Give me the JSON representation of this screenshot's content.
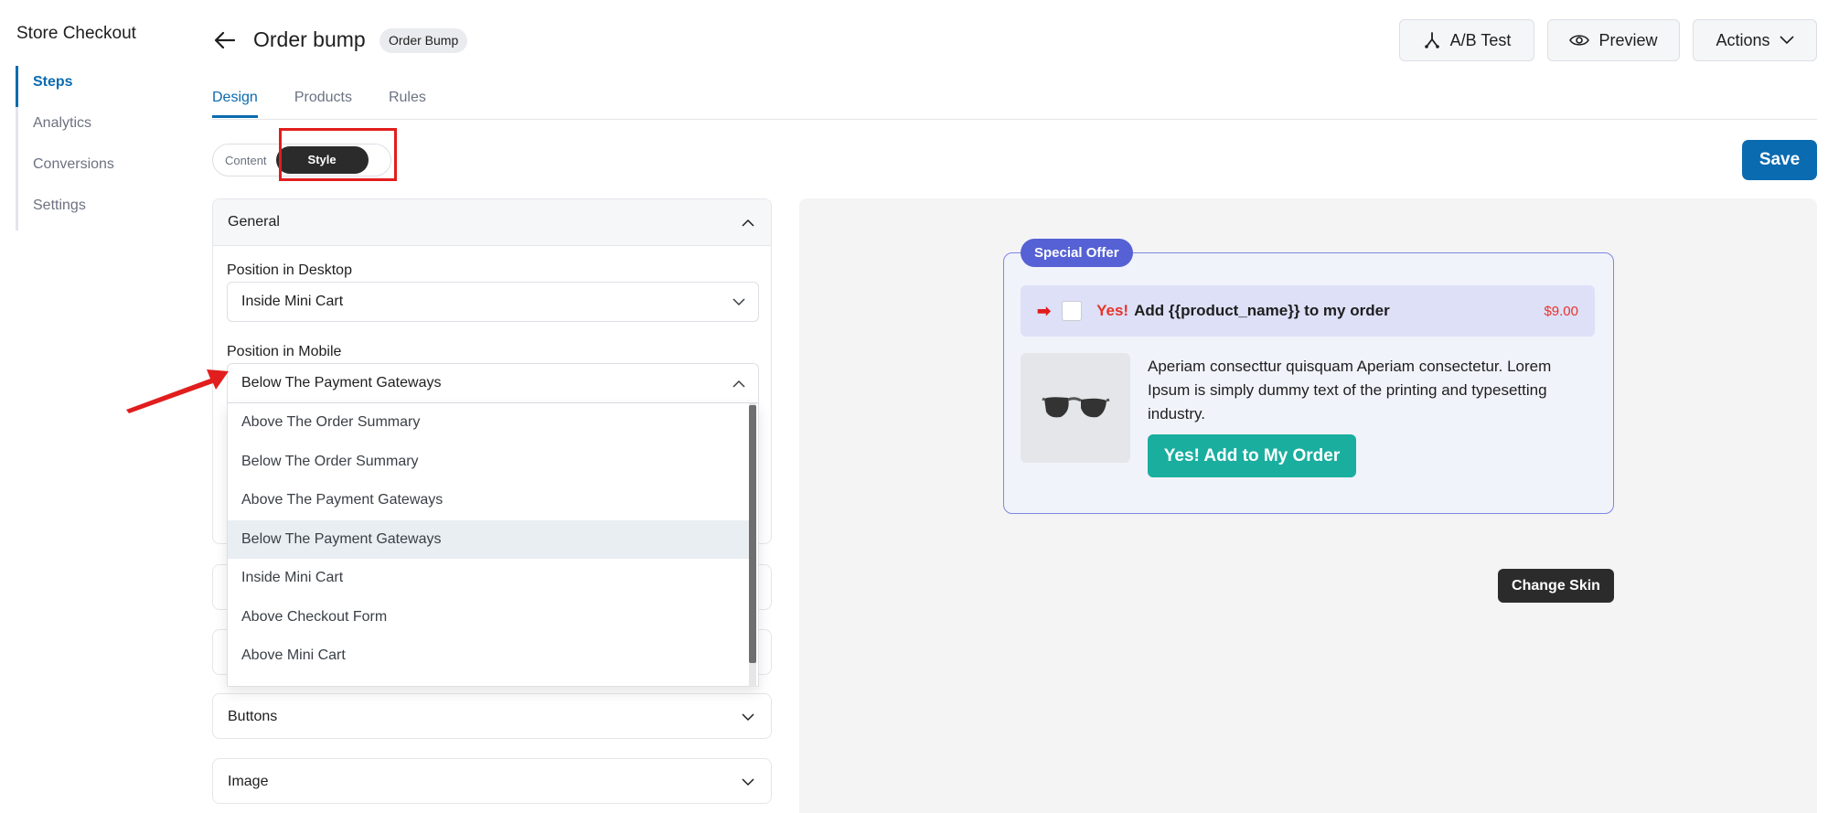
{
  "sidebar": {
    "title": "Store Checkout",
    "items": [
      {
        "label": "Steps",
        "active": true
      },
      {
        "label": "Analytics",
        "active": false
      },
      {
        "label": "Conversions",
        "active": false
      },
      {
        "label": "Settings",
        "active": false
      }
    ]
  },
  "header": {
    "title": "Order bump",
    "badge": "Order Bump",
    "ab_test_label": "A/B Test",
    "preview_label": "Preview",
    "actions_label": "Actions"
  },
  "tabs": [
    "Design",
    "Products",
    "Rules"
  ],
  "active_tab": "Design",
  "segment": {
    "content_label": "Content",
    "style_label": "Style",
    "active": "Style"
  },
  "save_label": "Save",
  "general": {
    "title": "General",
    "desktop_label": "Position in Desktop",
    "desktop_value": "Inside Mini Cart",
    "mobile_label": "Position in Mobile",
    "mobile_value": "Below The Payment Gateways",
    "mobile_options": [
      "Above The Order Summary",
      "Below The Order Summary",
      "Above The Payment Gateways",
      "Below The Payment Gateways",
      "Inside Mini Cart",
      "Above Checkout Form",
      "Above Mini Cart"
    ],
    "selected_option": "Below The Payment Gateways"
  },
  "sections": {
    "buttons": "Buttons",
    "image": "Image"
  },
  "preview": {
    "badge": "Special Offer",
    "yes": "Yes!",
    "headline": "Add {{product_name}} to my order",
    "price": "$9.00",
    "description": "Aperiam consecttur quisquam Aperiam consectetur. Lorem Ipsum is simply dummy text of the printing and typesetting industry.",
    "add_button": "Yes! Add to My Order",
    "change_skin": "Change Skin"
  },
  "colors": {
    "accent": "#0a6bb0",
    "badge": "#5561d4",
    "add_button": "#1aae9f",
    "highlight": "#e11d1d",
    "price": "#e6342a"
  }
}
